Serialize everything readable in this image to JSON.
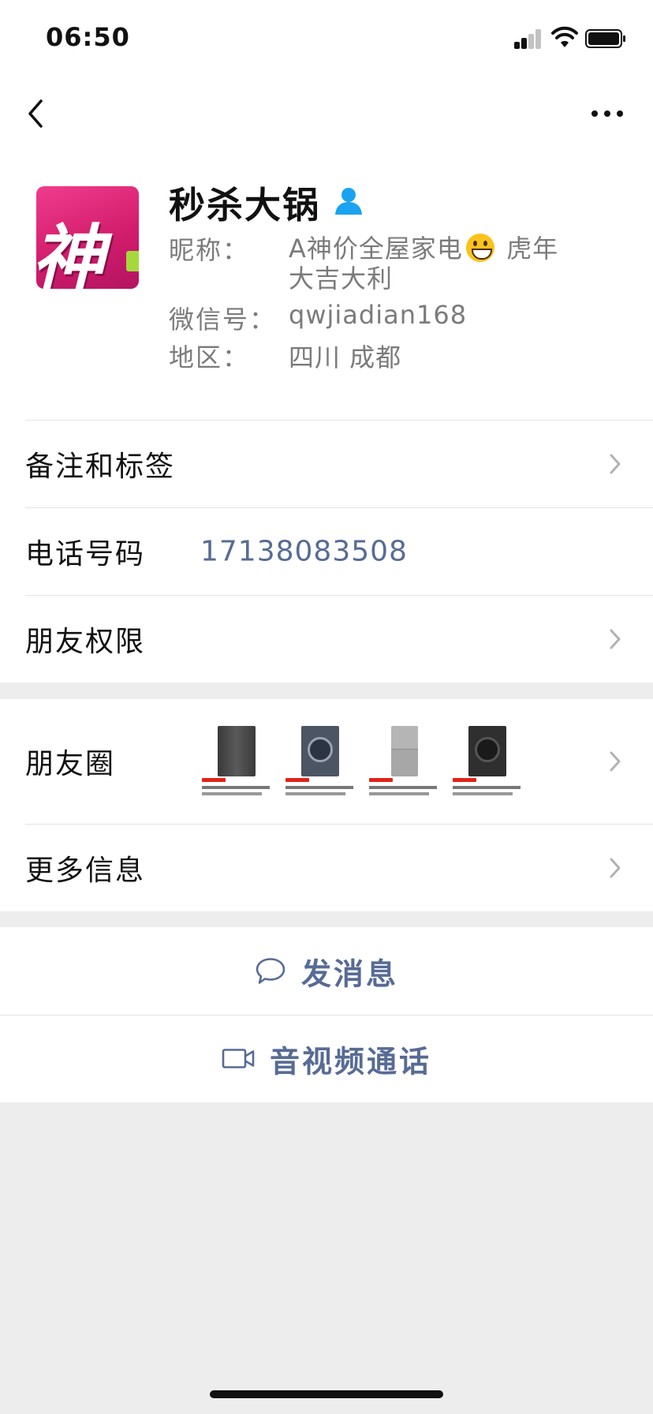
{
  "status_bar": {
    "time": "06:50"
  },
  "profile": {
    "display_name": "秒杀大锅",
    "nickname_label": "昵称：",
    "nickname_part1": "A神价全屋家电",
    "nickname_emoji": "grinning-face-emoji",
    "nickname_part2": " 虎年大吉大利",
    "wechat_id_label": "微信号：",
    "wechat_id": "qwjiadian168",
    "region_label": "地区：",
    "region": "四川 成都",
    "avatar_text": "神"
  },
  "rows": {
    "remarks_tags": "备注和标签",
    "phone_label": "电话号码",
    "phone_number": "17138083508",
    "friend_permissions": "朋友权限",
    "moments": "朋友圈",
    "more_info": "更多信息"
  },
  "actions": {
    "send_message": "发消息",
    "av_call": "音视频通话"
  },
  "moments_thumbnails": [
    {
      "product": "dark-gray-refrigerator",
      "color": "#4a4a4a"
    },
    {
      "product": "dark-blue-washing-machine",
      "color": "#4b5563"
    },
    {
      "product": "silver-refrigerator",
      "color": "#a7a7a7"
    },
    {
      "product": "black-washing-machine",
      "color": "#2f2f2f"
    }
  ],
  "colors": {
    "link_blue": "#576b95",
    "background": "#ededed",
    "verified_blue": "#1aa3f0"
  }
}
